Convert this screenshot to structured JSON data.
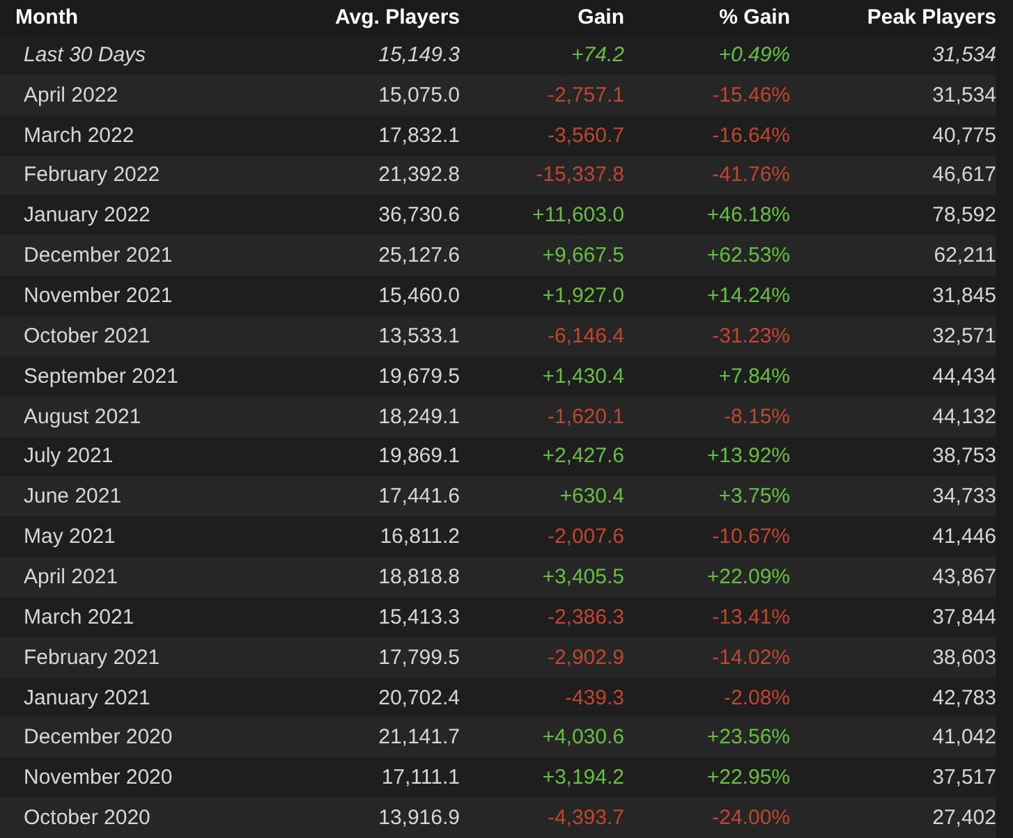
{
  "table": {
    "columns": [
      "Month",
      "Avg. Players",
      "Gain",
      "% Gain",
      "Peak Players"
    ],
    "rows": [
      {
        "kind": "summary",
        "month": "Last 30 Days",
        "avg": "15,149.3",
        "gain": "+74.2",
        "pct": "+0.49%",
        "peak": "31,534",
        "color": "#66c03b"
      },
      {
        "kind": "month",
        "month": "April 2022",
        "avg": "15,075.0",
        "gain": "-2,757.1",
        "pct": "-15.46%",
        "peak": "31,534",
        "color": "#c2452e"
      },
      {
        "kind": "month",
        "month": "March 2022",
        "avg": "17,832.1",
        "gain": "-3,560.7",
        "pct": "-16.64%",
        "peak": "40,775",
        "color": "#c2452e"
      },
      {
        "kind": "month",
        "month": "February 2022",
        "avg": "21,392.8",
        "gain": "-15,337.8",
        "pct": "-41.76%",
        "peak": "46,617",
        "color": "#c2452e"
      },
      {
        "kind": "month",
        "month": "January 2022",
        "avg": "36,730.6",
        "gain": "+11,603.0",
        "pct": "+46.18%",
        "peak": "78,592",
        "color": "#66c03b"
      },
      {
        "kind": "month",
        "month": "December 2021",
        "avg": "25,127.6",
        "gain": "+9,667.5",
        "pct": "+62.53%",
        "peak": "62,211",
        "color": "#66c03b"
      },
      {
        "kind": "month",
        "month": "November 2021",
        "avg": "15,460.0",
        "gain": "+1,927.0",
        "pct": "+14.24%",
        "peak": "31,845",
        "color": "#66c03b"
      },
      {
        "kind": "month",
        "month": "October 2021",
        "avg": "13,533.1",
        "gain": "-6,146.4",
        "pct": "-31.23%",
        "peak": "32,571",
        "color": "#c2452e"
      },
      {
        "kind": "month",
        "month": "September 2021",
        "avg": "19,679.5",
        "gain": "+1,430.4",
        "pct": "+7.84%",
        "peak": "44,434",
        "color": "#66c03b"
      },
      {
        "kind": "month",
        "month": "August 2021",
        "avg": "18,249.1",
        "gain": "-1,620.1",
        "pct": "-8.15%",
        "peak": "44,132",
        "color": "#c2452e"
      },
      {
        "kind": "month",
        "month": "July 2021",
        "avg": "19,869.1",
        "gain": "+2,427.6",
        "pct": "+13.92%",
        "peak": "38,753",
        "color": "#66c03b"
      },
      {
        "kind": "month",
        "month": "June 2021",
        "avg": "17,441.6",
        "gain": "+630.4",
        "pct": "+3.75%",
        "peak": "34,733",
        "color": "#66c03b"
      },
      {
        "kind": "month",
        "month": "May 2021",
        "avg": "16,811.2",
        "gain": "-2,007.6",
        "pct": "-10.67%",
        "peak": "41,446",
        "color": "#c2452e"
      },
      {
        "kind": "month",
        "month": "April 2021",
        "avg": "18,818.8",
        "gain": "+3,405.5",
        "pct": "+22.09%",
        "peak": "43,867",
        "color": "#66c03b"
      },
      {
        "kind": "month",
        "month": "March 2021",
        "avg": "15,413.3",
        "gain": "-2,386.3",
        "pct": "-13.41%",
        "peak": "37,844",
        "color": "#c2452e"
      },
      {
        "kind": "month",
        "month": "February 2021",
        "avg": "17,799.5",
        "gain": "-2,902.9",
        "pct": "-14.02%",
        "peak": "38,603",
        "color": "#c2452e"
      },
      {
        "kind": "month",
        "month": "January 2021",
        "avg": "20,702.4",
        "gain": "-439.3",
        "pct": "-2.08%",
        "peak": "42,783",
        "color": "#c2452e"
      },
      {
        "kind": "month",
        "month": "December 2020",
        "avg": "21,141.7",
        "gain": "+4,030.6",
        "pct": "+23.56%",
        "peak": "41,042",
        "color": "#66c03b"
      },
      {
        "kind": "month",
        "month": "November 2020",
        "avg": "17,111.1",
        "gain": "+3,194.2",
        "pct": "+22.95%",
        "peak": "37,517",
        "color": "#66c03b"
      },
      {
        "kind": "month",
        "month": "October 2020",
        "avg": "13,916.9",
        "gain": "-4,393.7",
        "pct": "-24.00%",
        "peak": "27,402",
        "color": "#c2452e"
      }
    ]
  }
}
